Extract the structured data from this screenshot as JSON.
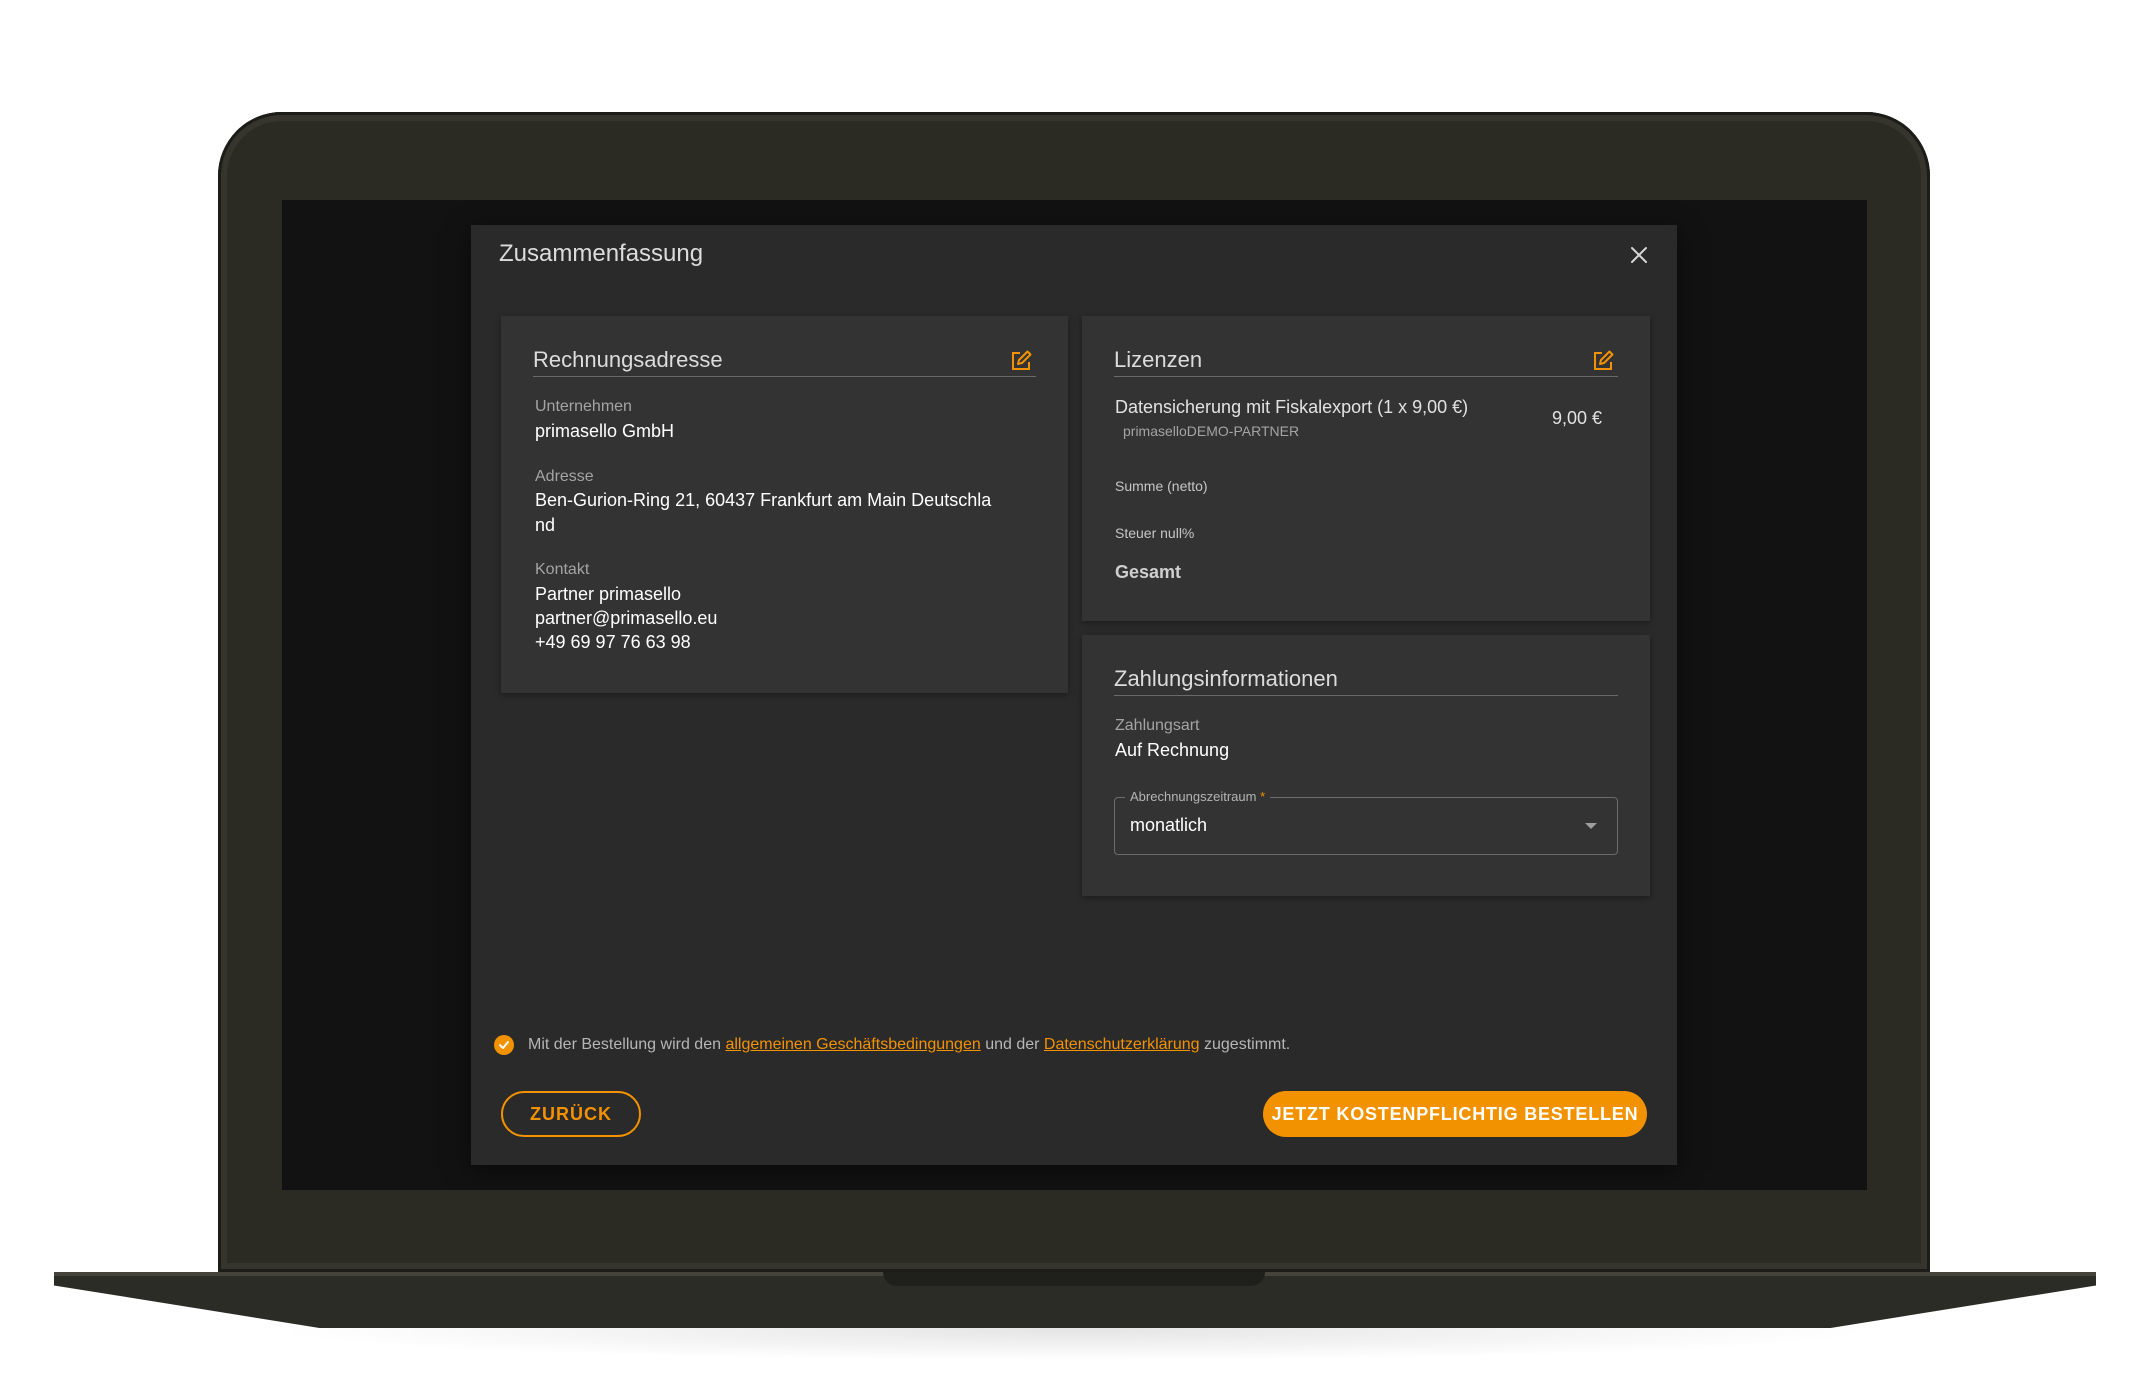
{
  "dialog": {
    "title": "Zusammenfassung"
  },
  "billing": {
    "title": "Rechnungsadresse",
    "company_label": "Unternehmen",
    "company_value": "primasello GmbH",
    "address_label": "Adresse",
    "address_line1": "Ben-Gurion-Ring 21, 60437 Frankfurt am Main Deutschla",
    "address_line2": "nd",
    "contact_label": "Kontakt",
    "contact_name": "Partner primasello",
    "contact_email": "partner@primasello.eu",
    "contact_phone": "+49 69 97 76 63 98"
  },
  "licenses": {
    "title": "Lizenzen",
    "item_name": "Datensicherung mit Fiskalexport (1 x 9,00 €)",
    "item_sub": "primaselloDEMO-PARTNER",
    "item_price": "9,00 €",
    "net_label": "Summe (netto)",
    "tax_label": "Steuer null%",
    "total_label": "Gesamt"
  },
  "payment": {
    "title": "Zahlungsinformationen",
    "method_label": "Zahlungsart",
    "method_value": "Auf Rechnung",
    "period_label": "Abrechnungszeitraum",
    "period_required": "*",
    "period_value": "monatlich"
  },
  "consent": {
    "pre": "Mit der Bestellung wird den",
    "link1": "allgemeinen Geschäftsbedingungen",
    "mid": "und der",
    "link2": "Datenschutzerklärung",
    "post": "zugestimmt."
  },
  "buttons": {
    "back": "ZURÜCK",
    "order": "JETZT KOSTENPFLICHTIG BESTELLEN"
  },
  "colors": {
    "accent": "#f39200",
    "dialog_bg": "#2a2a2a",
    "card_bg": "#333333",
    "screen_bg": "#121212",
    "device_body": "#2b2b24"
  },
  "icons": {
    "close": "close-icon",
    "edit": "edit-icon",
    "check": "check-icon",
    "dropdown": "chevron-down-icon"
  }
}
